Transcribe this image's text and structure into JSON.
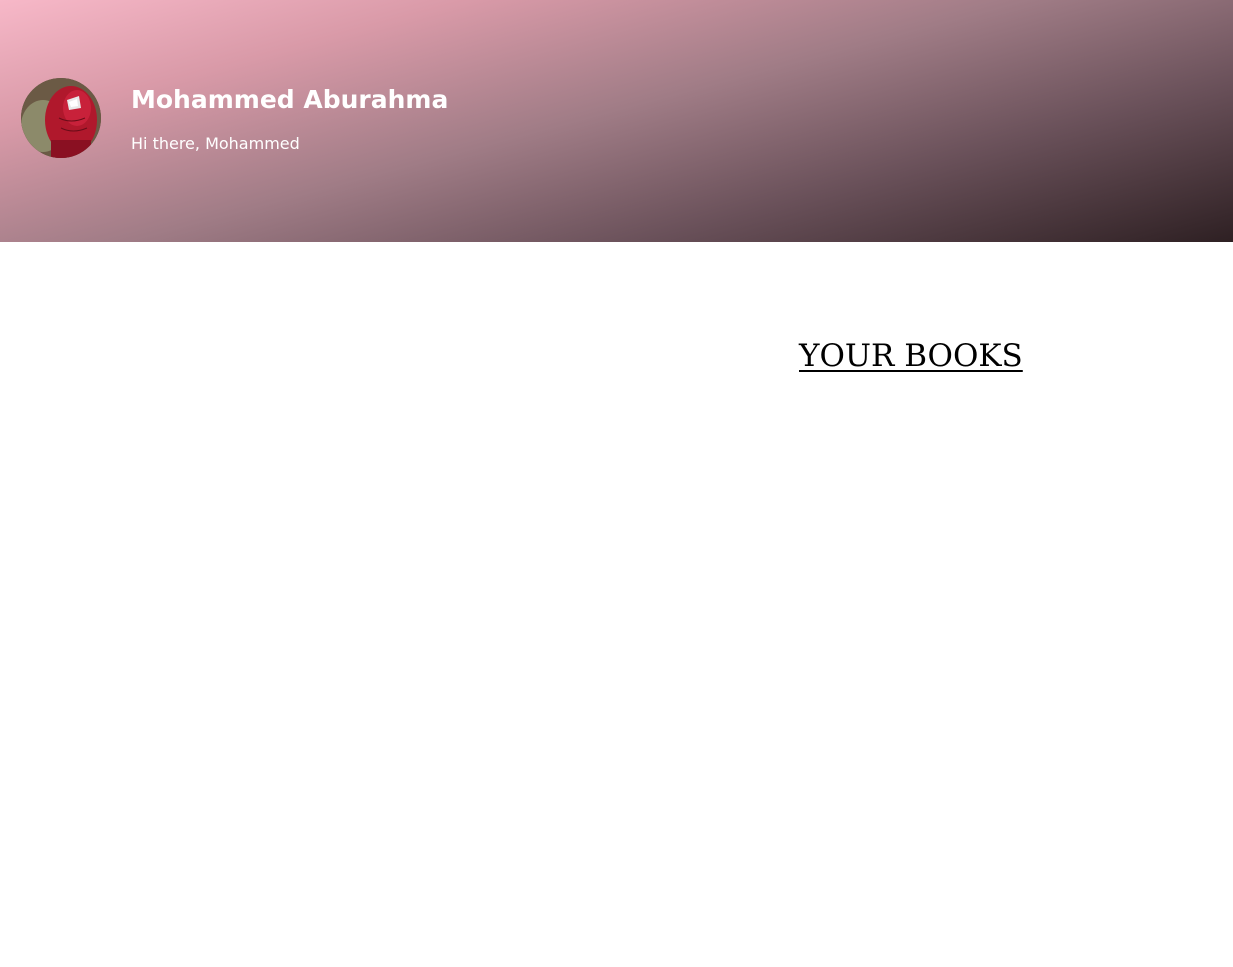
{
  "profile": {
    "name": "Mohammed Aburahma",
    "greeting": "Hi there, Mohammed",
    "avatar_icon": "spiderman-avatar"
  },
  "books_section": {
    "title": "YOUR BOOKS"
  },
  "colors": {
    "header_gradient_start": "#f7b8c8",
    "header_gradient_end": "#2e2023",
    "header_text": "#ffffff",
    "title_text": "#000000"
  }
}
